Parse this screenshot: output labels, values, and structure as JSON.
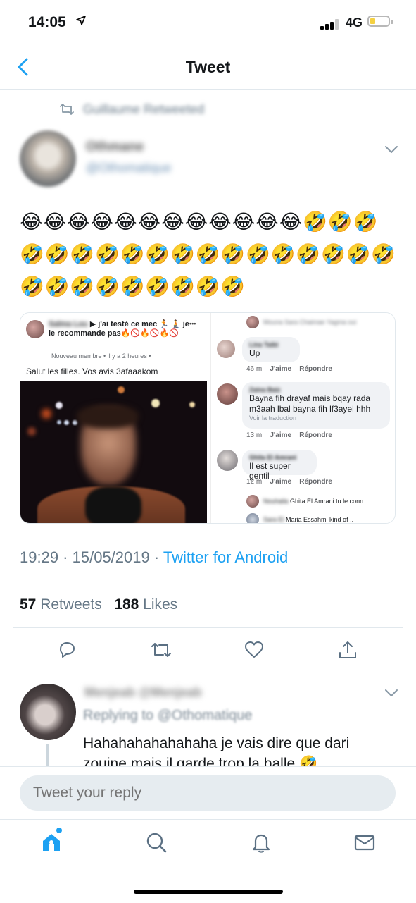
{
  "status_bar": {
    "time": "14:05",
    "network": "4G"
  },
  "nav": {
    "title": "Tweet"
  },
  "retweet_context": {
    "text": "Guillaume Retweeted"
  },
  "tweet": {
    "author_name": "Othmane",
    "author_handle": "@Othomatique",
    "emoji_rows": [
      "😂😂😂😂😂😂😂😂😂😂😂😂🤣🤣🤣",
      "🤣🤣🤣🤣🤣🤣🤣🤣🤣🤣🤣🤣🤣🤣🤣",
      "🤣🤣🤣🤣🤣🤣🤣🤣🤣"
    ],
    "time": "19:29",
    "date": "15/05/2019",
    "source": "Twitter for Android",
    "retweets_count": "57",
    "retweets_label": "Retweets",
    "likes_count": "188",
    "likes_label": "Likes"
  },
  "media": {
    "fb_post": {
      "header_name": "Salma Lou",
      "header_text": "▶ j'ai testé ce mec 🏃 🧎 je le recommande pas🔥🚫🔥🚫🔥🚫",
      "meta": "Nouveau membre • il y a 2 heures •",
      "more_icon": "•••",
      "body": "Salut les filles. Vos avis 3afaaakom"
    },
    "fb_comments": {
      "top_line": "Mouna Sara Chaimae Yagma oui",
      "comments": [
        {
          "author": "Lina Taibi",
          "text": "Up",
          "time": "46 m",
          "like": "J'aime",
          "reply": "Répondre",
          "translate": ""
        },
        {
          "author": "Zaina Baiz",
          "text": "Bayna fih drayaf mais bqay rada m3aah lbal bayna fih lf3ayel hhh",
          "time": "13 m",
          "like": "J'aime",
          "reply": "Répondre",
          "translate": "Voir la traduction"
        },
        {
          "author": "Ghita El Amrani",
          "text": "Il est super gentil",
          "time": "12 m",
          "like": "J'aime",
          "reply": "Répondre",
          "translate": ""
        }
      ],
      "sub_replies": [
        {
          "author": "Nouhaila",
          "text": "Ghita El Amrani tu le conn..."
        },
        {
          "author": "Sara El",
          "text": "Maria Essahmi kind of .."
        }
      ]
    }
  },
  "reply": {
    "author_name": "Menjeab  @Menjeab",
    "replying_label": "Replying to @Othomatique",
    "text": "Hahahahahahahaha je vais dire que dari zouine mais il garde trop la balle 🤣"
  },
  "compose": {
    "placeholder": "Tweet your reply"
  },
  "colors": {
    "accent": "#1da1f2",
    "secondary_text": "#657786",
    "divider": "#e1e8ed"
  },
  "icons": [
    "back-chevron-icon",
    "retweet-icon",
    "caret-down-icon",
    "reply-icon",
    "retweet-icon",
    "like-heart-icon",
    "share-icon",
    "home-icon",
    "search-icon",
    "notifications-bell-icon",
    "messages-envelope-icon"
  ]
}
